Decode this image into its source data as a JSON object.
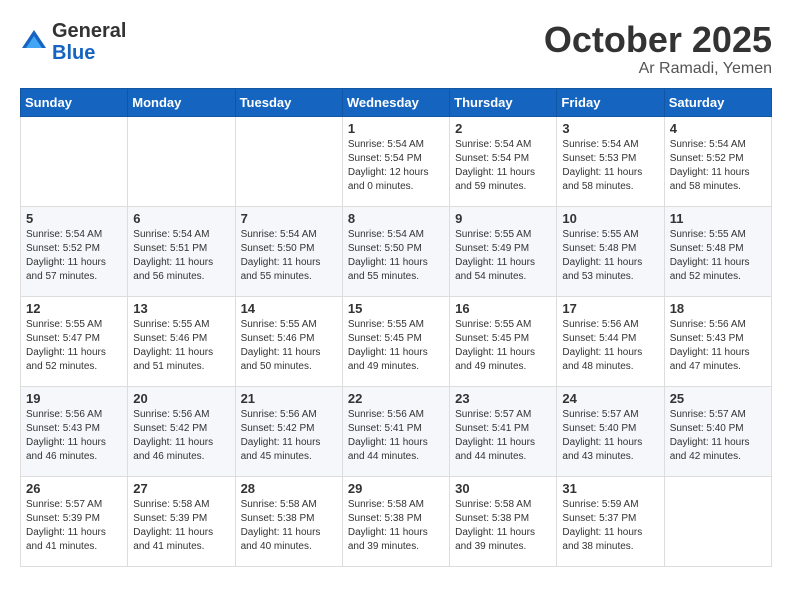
{
  "header": {
    "logo_general": "General",
    "logo_blue": "Blue",
    "month_title": "October 2025",
    "location": "Ar Ramadi, Yemen"
  },
  "weekdays": [
    "Sunday",
    "Monday",
    "Tuesday",
    "Wednesday",
    "Thursday",
    "Friday",
    "Saturday"
  ],
  "weeks": [
    [
      {
        "day": "",
        "info": ""
      },
      {
        "day": "",
        "info": ""
      },
      {
        "day": "",
        "info": ""
      },
      {
        "day": "1",
        "info": "Sunrise: 5:54 AM\nSunset: 5:54 PM\nDaylight: 12 hours\nand 0 minutes."
      },
      {
        "day": "2",
        "info": "Sunrise: 5:54 AM\nSunset: 5:54 PM\nDaylight: 11 hours\nand 59 minutes."
      },
      {
        "day": "3",
        "info": "Sunrise: 5:54 AM\nSunset: 5:53 PM\nDaylight: 11 hours\nand 58 minutes."
      },
      {
        "day": "4",
        "info": "Sunrise: 5:54 AM\nSunset: 5:52 PM\nDaylight: 11 hours\nand 58 minutes."
      }
    ],
    [
      {
        "day": "5",
        "info": "Sunrise: 5:54 AM\nSunset: 5:52 PM\nDaylight: 11 hours\nand 57 minutes."
      },
      {
        "day": "6",
        "info": "Sunrise: 5:54 AM\nSunset: 5:51 PM\nDaylight: 11 hours\nand 56 minutes."
      },
      {
        "day": "7",
        "info": "Sunrise: 5:54 AM\nSunset: 5:50 PM\nDaylight: 11 hours\nand 55 minutes."
      },
      {
        "day": "8",
        "info": "Sunrise: 5:54 AM\nSunset: 5:50 PM\nDaylight: 11 hours\nand 55 minutes."
      },
      {
        "day": "9",
        "info": "Sunrise: 5:55 AM\nSunset: 5:49 PM\nDaylight: 11 hours\nand 54 minutes."
      },
      {
        "day": "10",
        "info": "Sunrise: 5:55 AM\nSunset: 5:48 PM\nDaylight: 11 hours\nand 53 minutes."
      },
      {
        "day": "11",
        "info": "Sunrise: 5:55 AM\nSunset: 5:48 PM\nDaylight: 11 hours\nand 52 minutes."
      }
    ],
    [
      {
        "day": "12",
        "info": "Sunrise: 5:55 AM\nSunset: 5:47 PM\nDaylight: 11 hours\nand 52 minutes."
      },
      {
        "day": "13",
        "info": "Sunrise: 5:55 AM\nSunset: 5:46 PM\nDaylight: 11 hours\nand 51 minutes."
      },
      {
        "day": "14",
        "info": "Sunrise: 5:55 AM\nSunset: 5:46 PM\nDaylight: 11 hours\nand 50 minutes."
      },
      {
        "day": "15",
        "info": "Sunrise: 5:55 AM\nSunset: 5:45 PM\nDaylight: 11 hours\nand 49 minutes."
      },
      {
        "day": "16",
        "info": "Sunrise: 5:55 AM\nSunset: 5:45 PM\nDaylight: 11 hours\nand 49 minutes."
      },
      {
        "day": "17",
        "info": "Sunrise: 5:56 AM\nSunset: 5:44 PM\nDaylight: 11 hours\nand 48 minutes."
      },
      {
        "day": "18",
        "info": "Sunrise: 5:56 AM\nSunset: 5:43 PM\nDaylight: 11 hours\nand 47 minutes."
      }
    ],
    [
      {
        "day": "19",
        "info": "Sunrise: 5:56 AM\nSunset: 5:43 PM\nDaylight: 11 hours\nand 46 minutes."
      },
      {
        "day": "20",
        "info": "Sunrise: 5:56 AM\nSunset: 5:42 PM\nDaylight: 11 hours\nand 46 minutes."
      },
      {
        "day": "21",
        "info": "Sunrise: 5:56 AM\nSunset: 5:42 PM\nDaylight: 11 hours\nand 45 minutes."
      },
      {
        "day": "22",
        "info": "Sunrise: 5:56 AM\nSunset: 5:41 PM\nDaylight: 11 hours\nand 44 minutes."
      },
      {
        "day": "23",
        "info": "Sunrise: 5:57 AM\nSunset: 5:41 PM\nDaylight: 11 hours\nand 44 minutes."
      },
      {
        "day": "24",
        "info": "Sunrise: 5:57 AM\nSunset: 5:40 PM\nDaylight: 11 hours\nand 43 minutes."
      },
      {
        "day": "25",
        "info": "Sunrise: 5:57 AM\nSunset: 5:40 PM\nDaylight: 11 hours\nand 42 minutes."
      }
    ],
    [
      {
        "day": "26",
        "info": "Sunrise: 5:57 AM\nSunset: 5:39 PM\nDaylight: 11 hours\nand 41 minutes."
      },
      {
        "day": "27",
        "info": "Sunrise: 5:58 AM\nSunset: 5:39 PM\nDaylight: 11 hours\nand 41 minutes."
      },
      {
        "day": "28",
        "info": "Sunrise: 5:58 AM\nSunset: 5:38 PM\nDaylight: 11 hours\nand 40 minutes."
      },
      {
        "day": "29",
        "info": "Sunrise: 5:58 AM\nSunset: 5:38 PM\nDaylight: 11 hours\nand 39 minutes."
      },
      {
        "day": "30",
        "info": "Sunrise: 5:58 AM\nSunset: 5:38 PM\nDaylight: 11 hours\nand 39 minutes."
      },
      {
        "day": "31",
        "info": "Sunrise: 5:59 AM\nSunset: 5:37 PM\nDaylight: 11 hours\nand 38 minutes."
      },
      {
        "day": "",
        "info": ""
      }
    ]
  ]
}
